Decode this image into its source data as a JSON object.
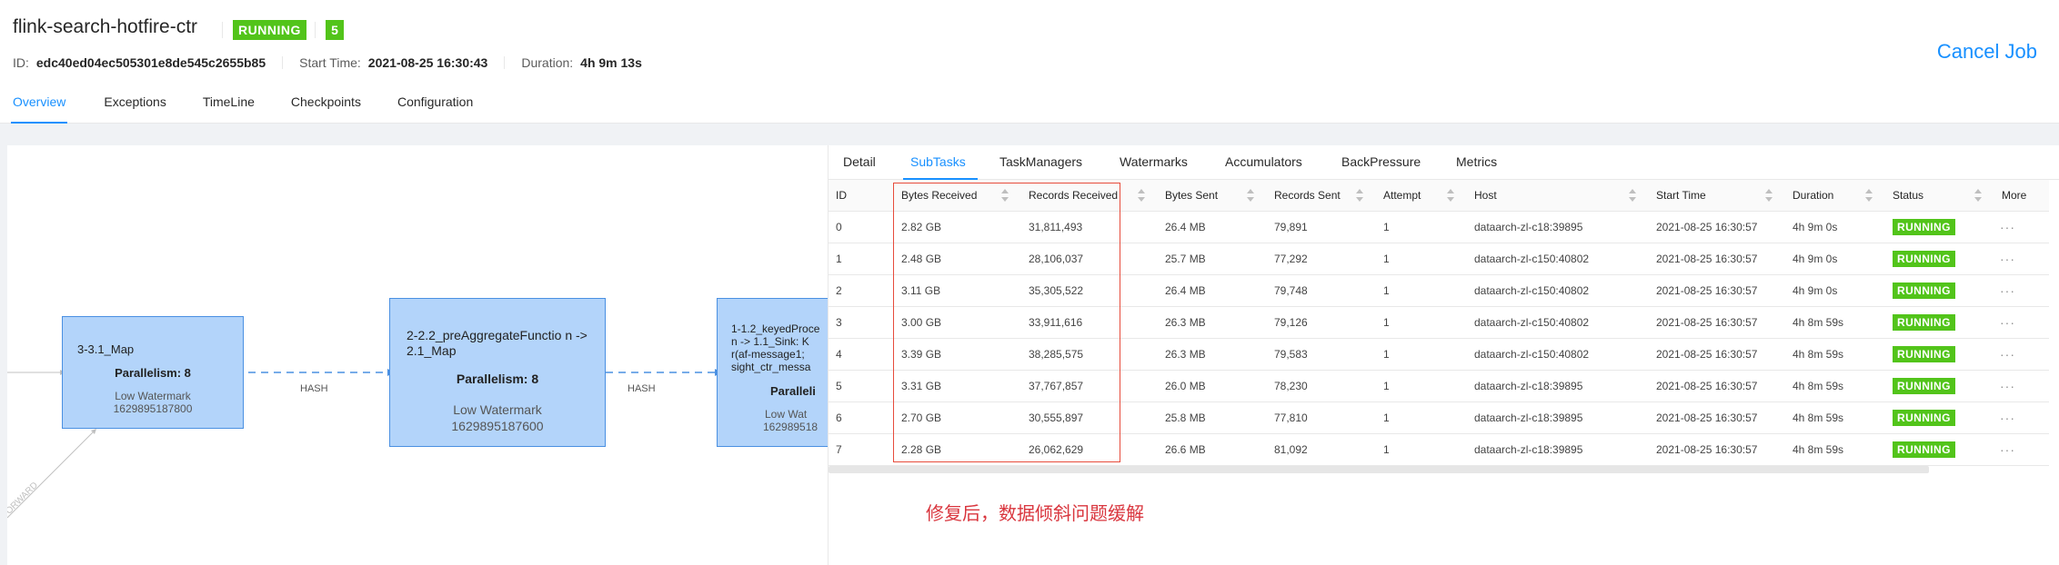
{
  "job": {
    "name": "flink-search-hotfire-ctr",
    "status": "RUNNING",
    "count": "5",
    "id_label": "ID:",
    "id": "edc40ed04ec505301e8de545c2655b85",
    "start_label": "Start Time:",
    "start": "2021-08-25 16:30:43",
    "duration_label": "Duration:",
    "duration": "4h 9m 13s"
  },
  "cancel_label": "Cancel Job",
  "top_tabs": [
    "Overview",
    "Exceptions",
    "TimeLine",
    "Checkpoints",
    "Configuration"
  ],
  "graph": {
    "nodes": [
      {
        "name": "3-3.1_Map",
        "parallelism": "Parallelism: 8",
        "wm_label": "Low Watermark",
        "wm_value": "1629895187800"
      },
      {
        "name": "2-2.2_preAggregateFunctio n -> 2.1_Map",
        "parallelism": "Parallelism: 8",
        "wm_label": "Low Watermark",
        "wm_value": "1629895187600"
      },
      {
        "name_l1": "1-1.2_keyedProce",
        "name_l2": "n -> 1.1_Sink: K",
        "name_l3": "r(af-message1;",
        "name_l4": "sight_ctr_messa",
        "parallelism": "Paralleli",
        "wm_label": "Low Wat",
        "wm_value": "162989518"
      }
    ],
    "edges": [
      "HASH",
      "HASH"
    ],
    "forward_label": "FORWARD"
  },
  "sub_tabs": [
    "Detail",
    "SubTasks",
    "TaskManagers",
    "Watermarks",
    "Accumulators",
    "BackPressure",
    "Metrics"
  ],
  "columns": [
    "ID",
    "Bytes Received",
    "Records Received",
    "Bytes Sent",
    "Records Sent",
    "Attempt",
    "Host",
    "Start Time",
    "Duration",
    "Status",
    "More"
  ],
  "rows": [
    {
      "id": "0",
      "bytes_received": "2.82 GB",
      "records_received": "31,811,493",
      "bytes_sent": "26.4 MB",
      "records_sent": "79,891",
      "attempt": "1",
      "host": "dataarch-zl-c18:39895",
      "start": "2021-08-25 16:30:57",
      "duration": "4h 9m 0s",
      "status": "RUNNING",
      "more": "···"
    },
    {
      "id": "1",
      "bytes_received": "2.48 GB",
      "records_received": "28,106,037",
      "bytes_sent": "25.7 MB",
      "records_sent": "77,292",
      "attempt": "1",
      "host": "dataarch-zl-c150:40802",
      "start": "2021-08-25 16:30:57",
      "duration": "4h 9m 0s",
      "status": "RUNNING",
      "more": "···"
    },
    {
      "id": "2",
      "bytes_received": "3.11 GB",
      "records_received": "35,305,522",
      "bytes_sent": "26.4 MB",
      "records_sent": "79,748",
      "attempt": "1",
      "host": "dataarch-zl-c150:40802",
      "start": "2021-08-25 16:30:57",
      "duration": "4h 9m 0s",
      "status": "RUNNING",
      "more": "···"
    },
    {
      "id": "3",
      "bytes_received": "3.00 GB",
      "records_received": "33,911,616",
      "bytes_sent": "26.3 MB",
      "records_sent": "79,126",
      "attempt": "1",
      "host": "dataarch-zl-c150:40802",
      "start": "2021-08-25 16:30:57",
      "duration": "4h 8m 59s",
      "status": "RUNNING",
      "more": "···"
    },
    {
      "id": "4",
      "bytes_received": "3.39 GB",
      "records_received": "38,285,575",
      "bytes_sent": "26.3 MB",
      "records_sent": "79,583",
      "attempt": "1",
      "host": "dataarch-zl-c150:40802",
      "start": "2021-08-25 16:30:57",
      "duration": "4h 8m 59s",
      "status": "RUNNING",
      "more": "···"
    },
    {
      "id": "5",
      "bytes_received": "3.31 GB",
      "records_received": "37,767,857",
      "bytes_sent": "26.0 MB",
      "records_sent": "78,230",
      "attempt": "1",
      "host": "dataarch-zl-c18:39895",
      "start": "2021-08-25 16:30:57",
      "duration": "4h 8m 59s",
      "status": "RUNNING",
      "more": "···"
    },
    {
      "id": "6",
      "bytes_received": "2.70 GB",
      "records_received": "30,555,897",
      "bytes_sent": "25.8 MB",
      "records_sent": "77,810",
      "attempt": "1",
      "host": "dataarch-zl-c18:39895",
      "start": "2021-08-25 16:30:57",
      "duration": "4h 8m 59s",
      "status": "RUNNING",
      "more": "···"
    },
    {
      "id": "7",
      "bytes_received": "2.28 GB",
      "records_received": "26,062,629",
      "bytes_sent": "26.6 MB",
      "records_sent": "81,092",
      "attempt": "1",
      "host": "dataarch-zl-c18:39895",
      "start": "2021-08-25 16:30:57",
      "duration": "4h 8m 59s",
      "status": "RUNNING",
      "more": "···"
    }
  ],
  "annotation": "修复后，数据倾斜问题缓解",
  "colors": {
    "accent": "#1890ff",
    "running": "#52c41a",
    "node_fill": "#b3d4fa",
    "node_border": "#4a90e2",
    "annotation": "#d9363e"
  }
}
